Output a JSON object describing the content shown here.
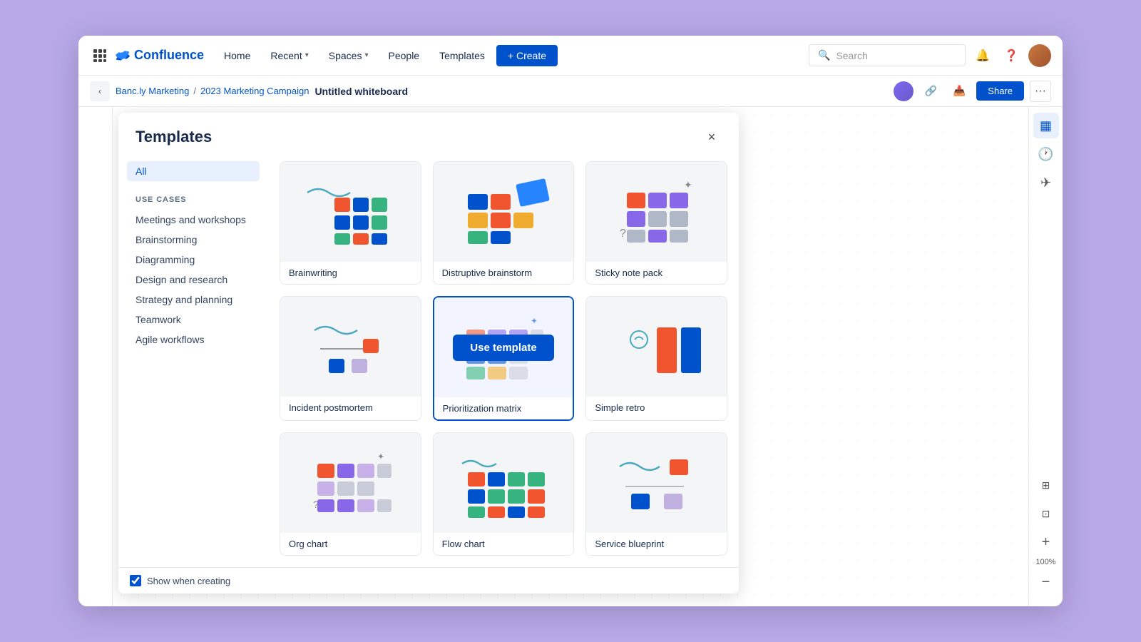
{
  "app": {
    "name": "Confluence"
  },
  "nav": {
    "grid_icon": "⊞",
    "home": "Home",
    "recent": "Recent",
    "spaces": "Spaces",
    "people": "People",
    "templates": "Templates",
    "create": "+ Create",
    "search_placeholder": "Search"
  },
  "breadcrumb": {
    "parent1": "Banc.ly Marketing",
    "separator": "/",
    "parent2": "2023 Marketing Campaign",
    "title": "Untitled whiteboard"
  },
  "toolbar": {
    "share": "Share"
  },
  "modal": {
    "title": "Templates",
    "close": "×",
    "filter_all": "All",
    "use_cases_label": "USE CASES",
    "filters": [
      "Meetings and workshops",
      "Brainstorming",
      "Diagramming",
      "Design and research",
      "Strategy and planning",
      "Teamwork",
      "Agile workflows"
    ],
    "templates": [
      {
        "id": "brainwriting",
        "label": "Brainwriting",
        "highlighted": false,
        "show_use_template": false
      },
      {
        "id": "distruptive-brainstorm",
        "label": "Distruptive brainstorm",
        "highlighted": false,
        "show_use_template": false
      },
      {
        "id": "sticky-note-pack",
        "label": "Sticky note pack",
        "highlighted": false,
        "show_use_template": false
      },
      {
        "id": "incident-postmortem",
        "label": "Incident postmortem",
        "highlighted": false,
        "show_use_template": false
      },
      {
        "id": "prioritization-matrix",
        "label": "Prioritization matrix",
        "highlighted": true,
        "show_use_template": true
      },
      {
        "id": "simple-retro",
        "label": "Simple retro",
        "highlighted": false,
        "show_use_template": false
      },
      {
        "id": "org-chart",
        "label": "Org chart",
        "highlighted": false,
        "show_use_template": false
      },
      {
        "id": "flow-chart",
        "label": "Flow chart",
        "highlighted": false,
        "show_use_template": false
      },
      {
        "id": "service-blueprint",
        "label": "Service blueprint",
        "highlighted": false,
        "show_use_template": false
      }
    ],
    "use_template_btn": "Use template",
    "show_when_creating_label": "Show when creating",
    "show_when_creating_checked": true
  },
  "zoom": {
    "level": "100%"
  },
  "colors": {
    "brand": "#0052cc",
    "bg_purple": "#b8a8e8",
    "card_border": "#e8e8e8",
    "card_selected": "#0052cc"
  }
}
